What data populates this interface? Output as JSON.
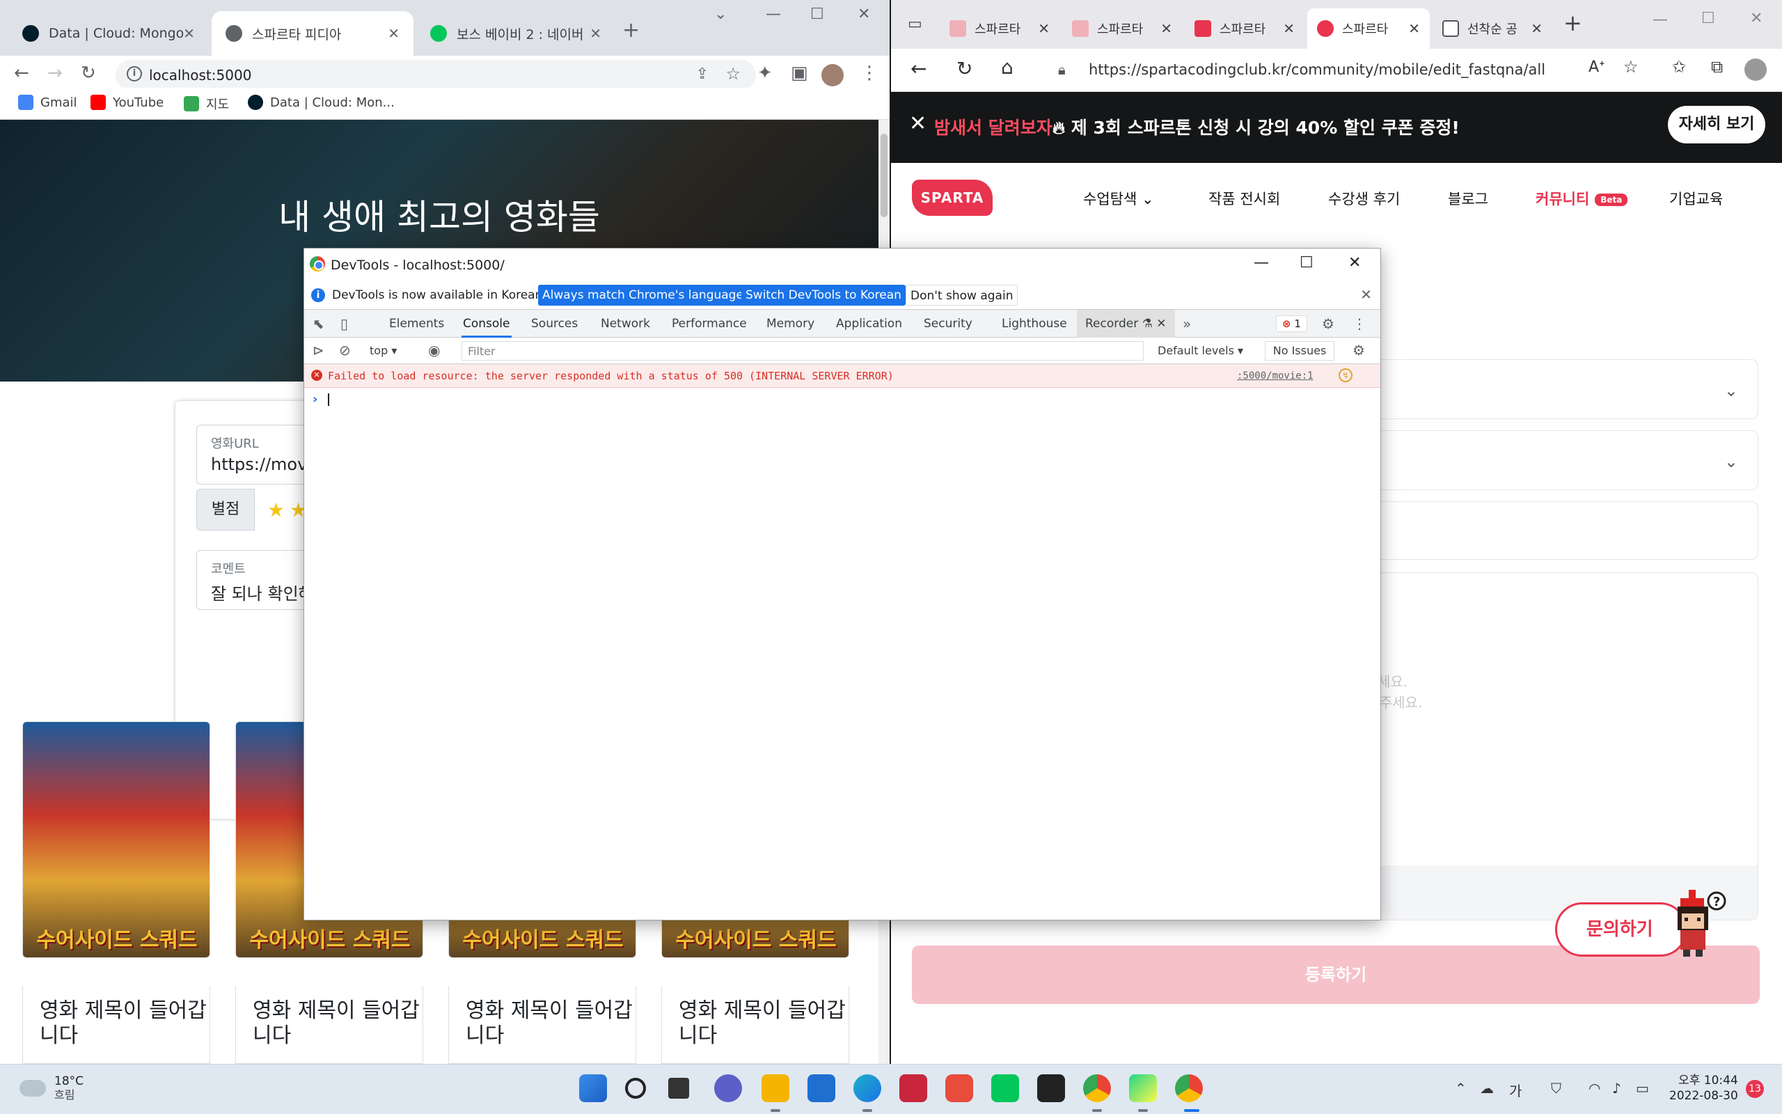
{
  "left_browser": {
    "tabs": [
      {
        "title": "Data | Cloud: MongoDB",
        "active": false
      },
      {
        "title": "스파르타 피디아",
        "active": true
      },
      {
        "title": "보스 베이비 2 : 네이버",
        "active": false
      }
    ],
    "url": "localhost:5000",
    "bookmarks": [
      "Gmail",
      "YouTube",
      "지도",
      "Data | Cloud: Mon..."
    ],
    "page": {
      "hero_title": "내 생애 최고의 영화들",
      "form": {
        "url_label": "영화URL",
        "url_value": "https://movi",
        "star_label": "별점",
        "comment_label": "코멘트",
        "comment_value": "잘 되나 확인해"
      },
      "cards": [
        {
          "title": "영화 제목이 들어갑니다",
          "poster_text": "수어사이드 스쿼드"
        },
        {
          "title": "영화 제목이 들어갑니다",
          "poster_text": "수어사이드 스쿼드"
        },
        {
          "title": "영화 제목이 들어갑니다",
          "poster_text": "수어사이드 스쿼드"
        },
        {
          "title": "영화 제목이 들어갑니다",
          "poster_text": "수어사이드 스쿼드"
        }
      ]
    }
  },
  "devtools": {
    "title": "DevTools - localhost:5000/",
    "infobar": {
      "message": "DevTools is now available in Korean!",
      "btn_match": "Always match Chrome's language",
      "btn_switch": "Switch DevTools to Korean",
      "btn_dismiss": "Don't show again"
    },
    "tabs": [
      "Elements",
      "Console",
      "Sources",
      "Network",
      "Performance",
      "Memory",
      "Application",
      "Security",
      "Lighthouse",
      "Recorder"
    ],
    "active_tab": "Console",
    "error_count": "1",
    "console_bar": {
      "context": "top",
      "filter_placeholder": "Filter",
      "levels": "Default levels",
      "issues": "No Issues"
    },
    "error": {
      "message": "Failed to load resource: the server responded with a status of 500 (INTERNAL SERVER ERROR)",
      "source": ":5000/movie:1"
    }
  },
  "right_browser": {
    "tabs": [
      {
        "title": "스파르타",
        "active": false
      },
      {
        "title": "스파르타",
        "active": false
      },
      {
        "title": "스파르타",
        "active": false
      },
      {
        "title": "스파르타",
        "active": true
      },
      {
        "title": "선착순 공",
        "active": false
      }
    ],
    "url": "https://spartacodingclub.kr/community/mobile/edit_fastqna/all",
    "promo": {
      "highlight": "밤새서 달려보자",
      "text": " 제 3회 스파르톤 신청 시 강의 40% 할인 쿠폰 증정!",
      "button": "자세히 보기"
    },
    "logo": "SPARTA",
    "nav": [
      "수업탐색",
      "작품 전시회",
      "수강생 후기",
      "블로그",
      "커뮤니티",
      "기업교육"
    ],
    "nav_badge": "Beta",
    "placeholder_1": "세요.",
    "placeholder_2": "해 주세요.",
    "submit": "등록하기",
    "inquiry": "문의하기"
  },
  "taskbar": {
    "temp": "18°C",
    "condition": "흐림",
    "time": "오후 10:44",
    "date": "2022-08-30",
    "notifications": "13",
    "ime": "가"
  },
  "colors": {
    "accent_red": "#e8344e",
    "devtools_blue": "#1a73e8",
    "error_red": "#d93025"
  }
}
